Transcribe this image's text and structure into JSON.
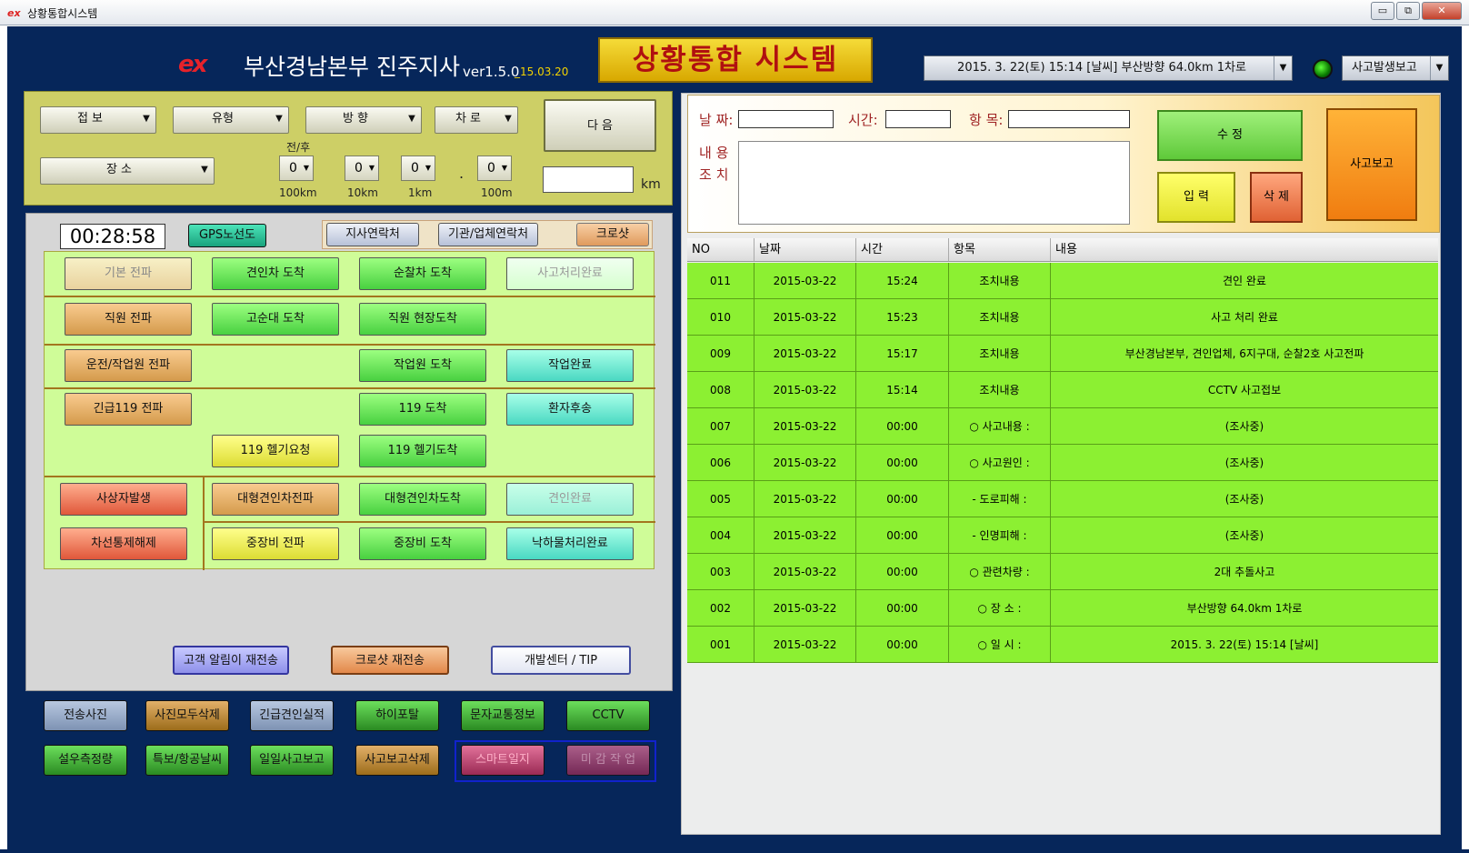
{
  "window": {
    "title": "상황통합시스템",
    "icon": "ex-logo-icon",
    "min": "▭",
    "max": "⧉",
    "close": "✕"
  },
  "header": {
    "logo": "ex",
    "branch": "부산경남본부 진주지사",
    "version": "ver1.5.0",
    "version_date": "_15.03.20",
    "system_title": "상황통합 시스템",
    "info_combo": "2015. 3. 22(토) 15:14 [날씨] 부산방향 64.0km 1차로",
    "report_combo": "사고발생보고"
  },
  "filters": {
    "jeopbo": "접 보",
    "type": "유형",
    "direction": "방 향",
    "lane": "차 로",
    "place": "장 소",
    "next": "다 음",
    "front_back": "전/후",
    "digit1": "0",
    "digit2": "0",
    "digit3": "0",
    "digit4": "0",
    "dot": ".",
    "u1": "100km",
    "u2": "10km",
    "u3": "1km",
    "u4": "100m",
    "km": "km"
  },
  "toolbar": {
    "timer": "00:28:58",
    "gps": "GPS노선도",
    "branch_contact": "지사연락처",
    "agency_contact": "기관/업체연락처",
    "crosshot": "크로샷"
  },
  "actions": {
    "b1": "기본 전파",
    "b2": "견인차 도착",
    "b3": "순찰차 도착",
    "b4": "사고처리완료",
    "b5": "직원 전파",
    "b6": "고순대 도착",
    "b7": "직원 현장도착",
    "b8": "운전/작업원 전파",
    "b9": "작업원 도착",
    "b10": "작업완료",
    "b11": "긴급119 전파",
    "b12": "119 도착",
    "b13": "환자후송",
    "b14": "119 헬기요청",
    "b15": "119 헬기도착",
    "b16": "사상자발생",
    "b17": "대형견인차전파",
    "b18": "대형견인차도착",
    "b19": "견인완료",
    "b20": "차선통제해제",
    "b21": "중장비 전파",
    "b22": "중장비 도착",
    "b23": "낙하물처리완료"
  },
  "resend": {
    "customer": "고객 알림이 재전송",
    "crosshot": "크로샷 재전송",
    "devcenter": "개발센터 / TIP"
  },
  "bottom": {
    "b1": "전송사진",
    "b2": "사진모두삭제",
    "b3": "긴급견인실적",
    "b4": "하이포탈",
    "b5": "문자교통정보",
    "b6": "CCTV",
    "b7": "설우측정량",
    "b8": "특보/항공날씨",
    "b9": "일일사고보고",
    "b10": "사고보고삭제",
    "b11": "스마트일지",
    "b12": "미 감 작 업"
  },
  "form": {
    "date_label": "날 짜:",
    "time_label": "시간:",
    "item_label": "항 목:",
    "content_label": "내 용",
    "action_label": "조 치",
    "edit": "수 정",
    "input": "입 력",
    "delete": "삭 제",
    "report": "사고보고"
  },
  "table": {
    "headers": [
      "NO",
      "날짜",
      "시간",
      "항목",
      "내용"
    ],
    "rows": [
      [
        "011",
        "2015-03-22",
        "15:24",
        "조치내용",
        "견인 완료"
      ],
      [
        "010",
        "2015-03-22",
        "15:23",
        "조치내용",
        "사고 처리 완료"
      ],
      [
        "009",
        "2015-03-22",
        "15:17",
        "조치내용",
        "부산경남본부, 견인업체, 6지구대, 순찰2호 사고전파"
      ],
      [
        "008",
        "2015-03-22",
        "15:14",
        "조치내용",
        "CCTV 사고접보"
      ],
      [
        "007",
        "2015-03-22",
        "00:00",
        "○ 사고내용 :",
        "(조사중)"
      ],
      [
        "006",
        "2015-03-22",
        "00:00",
        "○ 사고원인 :",
        "(조사중)"
      ],
      [
        "005",
        "2015-03-22",
        "00:00",
        "- 도로피해 :",
        "(조사중)"
      ],
      [
        "004",
        "2015-03-22",
        "00:00",
        "- 인명피해 :",
        "(조사중)"
      ],
      [
        "003",
        "2015-03-22",
        "00:00",
        "○ 관련차량 :",
        "2대  추돌사고"
      ],
      [
        "002",
        "2015-03-22",
        "00:00",
        "○ 장  소 :",
        "부산방향 64.0km 1차로"
      ],
      [
        "001",
        "2015-03-22",
        "00:00",
        "○ 일  시 :",
        "2015. 3. 22(토) 15:14 [날씨]"
      ]
    ]
  },
  "colors": {
    "frame": "#06265a",
    "row_green": "#8cf032",
    "title_gold": "#f5db38",
    "title_red": "#b01010"
  }
}
